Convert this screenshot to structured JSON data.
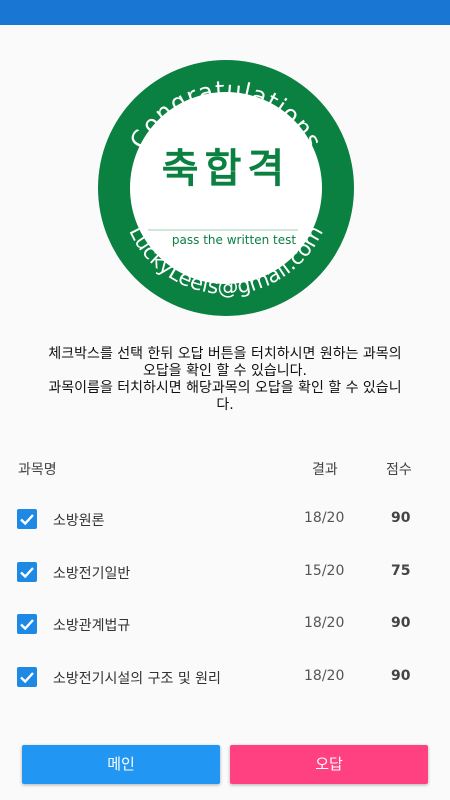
{
  "colors": {
    "status_bar": "#1976d2",
    "stamp_green": "#0a8041",
    "checkbox": "#1e88e5",
    "main_button": "#2196f3",
    "wrong_button": "#ff4081"
  },
  "stamp": {
    "top_text": "Congratulations",
    "center_text": "축합격",
    "sub_text": "pass the written test",
    "bottom_text": "LuckyLeeis@gmail.com"
  },
  "instructions": {
    "line1": "체크박스를 선택 한뒤 오답 버튼을 터치하시면 원하는 과목의\n오답을 확인 할 수 있습니다.",
    "line2": "과목이름을 터치하시면 해당과목의 오답을 확인 할 수 있습니\n다."
  },
  "table": {
    "headers": {
      "subject": "과목명",
      "result": "결과",
      "score": "점수"
    },
    "rows": [
      {
        "checked": true,
        "name": "소방원론",
        "result": "18/20",
        "score": "90"
      },
      {
        "checked": true,
        "name": "소방전기일반",
        "result": "15/20",
        "score": "75"
      },
      {
        "checked": true,
        "name": "소방관계법규",
        "result": "18/20",
        "score": "90"
      },
      {
        "checked": true,
        "name": "소방전기시설의 구조 및 원리",
        "result": "18/20",
        "score": "90"
      }
    ]
  },
  "buttons": {
    "main": "메인",
    "wrong": "오답"
  }
}
